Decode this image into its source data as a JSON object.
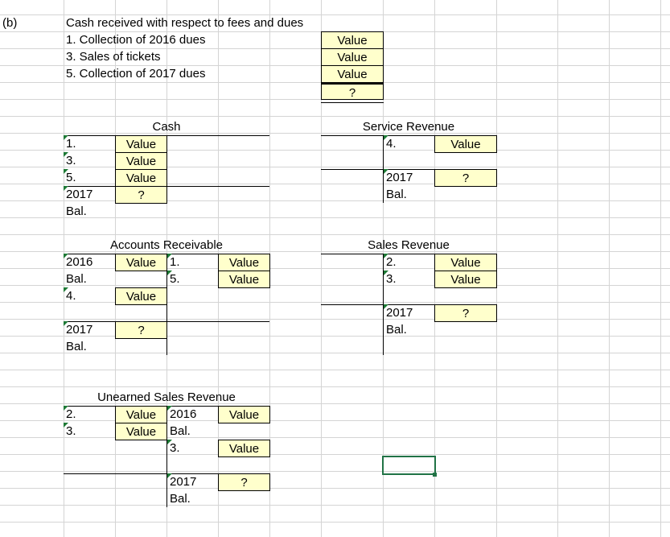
{
  "part_label": "(b)",
  "summary": {
    "heading": "Cash received with respect to fees and dues",
    "items": [
      {
        "label": "1.  Collection of 2016 dues",
        "value": "Value"
      },
      {
        "label": "3.  Sales of tickets",
        "value": "Value"
      },
      {
        "label": "5.  Collection of 2017 dues",
        "value": "Value"
      }
    ],
    "total": "?"
  },
  "accounts": {
    "cash": {
      "title": "Cash",
      "debits": [
        {
          "ref": "1.",
          "value": "Value"
        },
        {
          "ref": "3.",
          "value": "Value"
        },
        {
          "ref": "5.",
          "value": "Value"
        }
      ],
      "balance": {
        "ref": "2017",
        "ref2": "Bal.",
        "value": "?"
      }
    },
    "service_revenue": {
      "title": "Service Revenue",
      "credits": [
        {
          "ref": "4.",
          "value": "Value"
        }
      ],
      "balance": {
        "ref": "2017",
        "ref2": "Bal.",
        "value": "?"
      }
    },
    "accounts_receivable": {
      "title": "Accounts Receivable",
      "opening": {
        "ref": "2016",
        "ref2": "Bal.",
        "value": "Value"
      },
      "debits": [
        {
          "ref": "4.",
          "value": "Value"
        }
      ],
      "credits": [
        {
          "ref": "1.",
          "value": "Value"
        },
        {
          "ref": "5.",
          "value": "Value"
        }
      ],
      "balance": {
        "ref": "2017",
        "ref2": "Bal.",
        "value": "?"
      }
    },
    "sales_revenue": {
      "title": "Sales Revenue",
      "credits": [
        {
          "ref": "2.",
          "value": "Value"
        },
        {
          "ref": "3.",
          "value": "Value"
        }
      ],
      "balance": {
        "ref": "2017",
        "ref2": "Bal.",
        "value": "?"
      }
    },
    "unearned_sales_revenue": {
      "title": "Unearned Sales Revenue",
      "debits": [
        {
          "ref": "2.",
          "value": "Value"
        },
        {
          "ref": "3.",
          "value": "Value"
        }
      ],
      "opening": {
        "ref": "2016",
        "ref2": "Bal.",
        "value": "Value"
      },
      "credits": [
        {
          "ref": "3.",
          "value": "Value"
        }
      ],
      "balance": {
        "ref": "2017",
        "ref2": "Bal.",
        "value": "?"
      }
    }
  },
  "colors": {
    "input_fill": "#ffffcc",
    "gridline": "#d4d4d4",
    "selection": "#217346",
    "error_triangle": "#1e7a36"
  }
}
